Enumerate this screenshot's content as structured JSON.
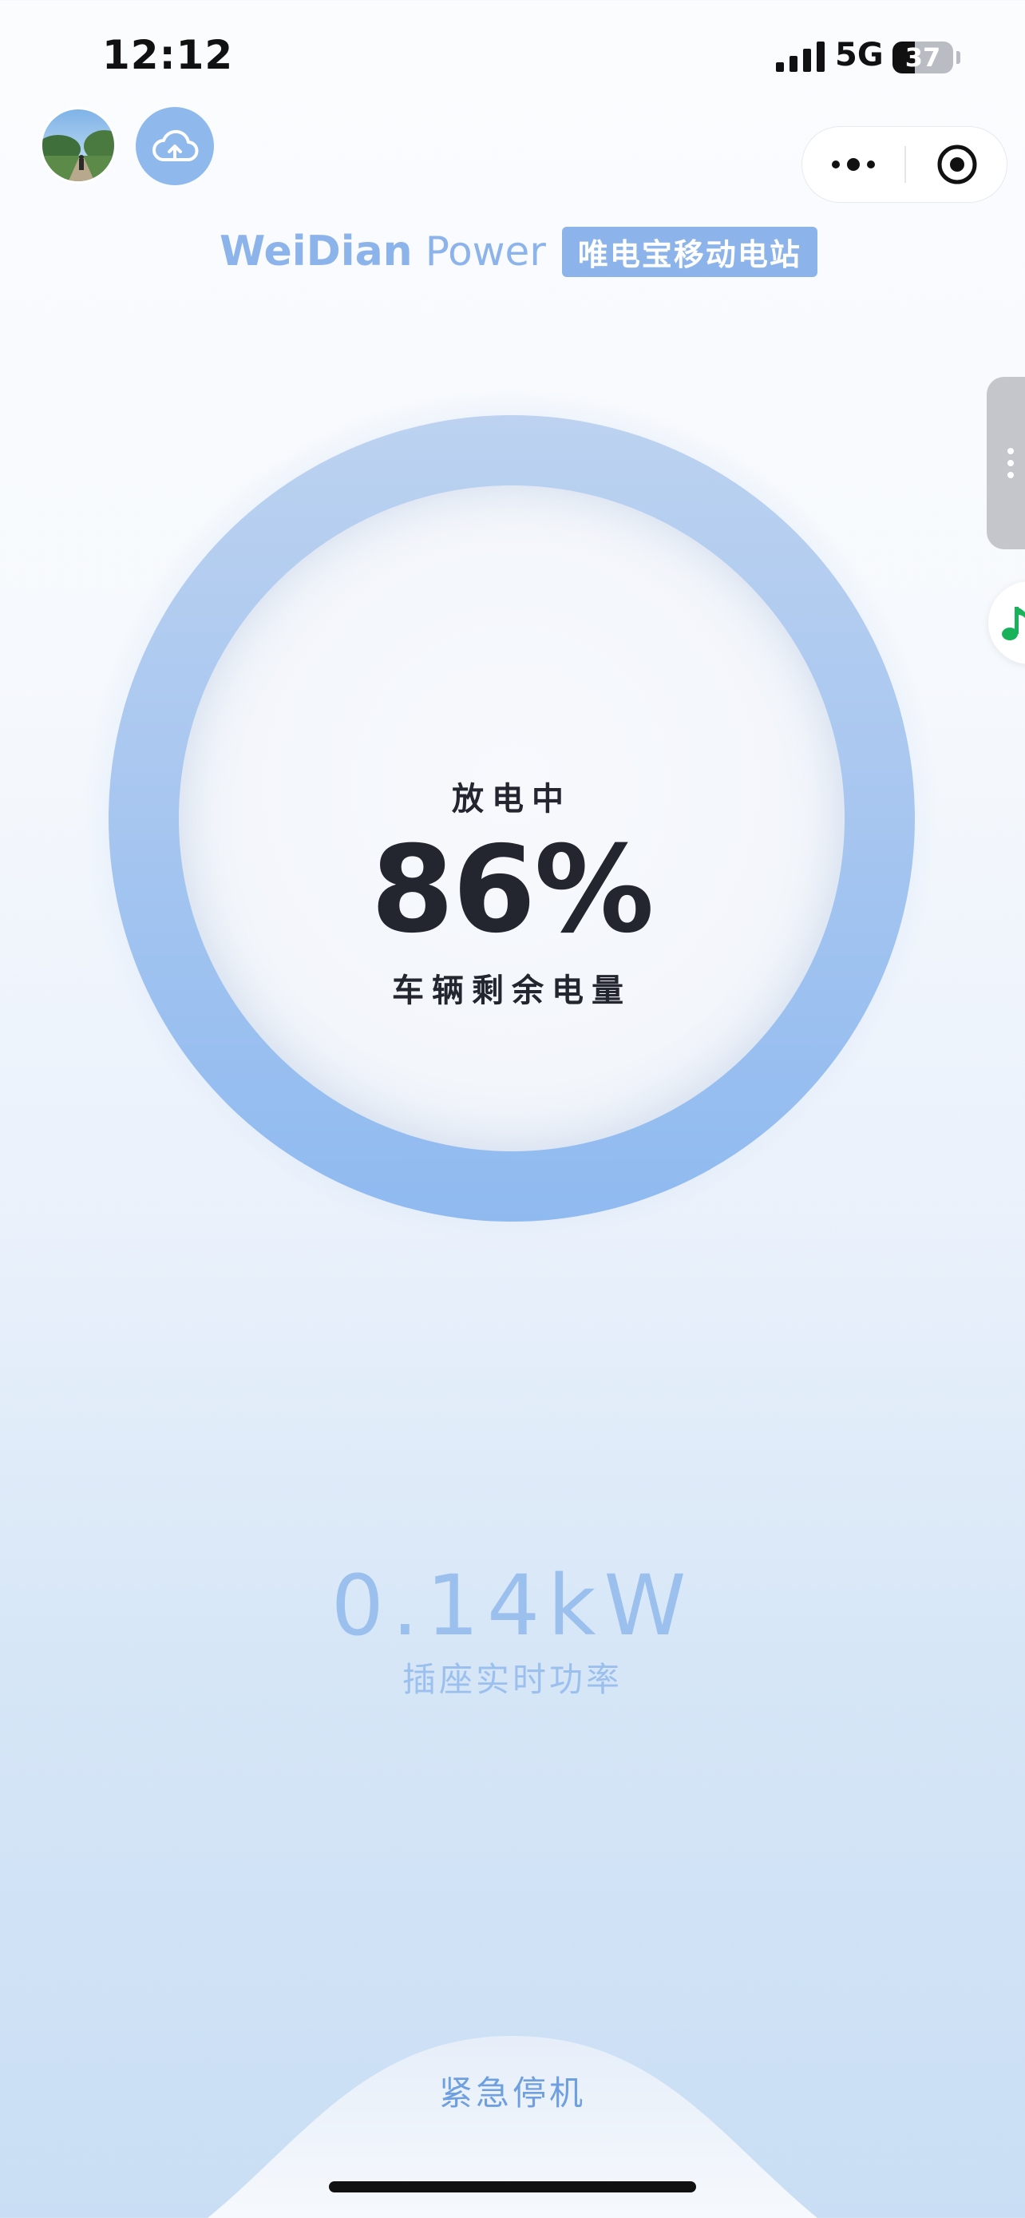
{
  "status_bar": {
    "time": "12:12",
    "network": "5G",
    "battery_text": "37",
    "battery_level": 0.37
  },
  "header": {
    "avatar_icon": "avatar-photo",
    "upload_icon": "cloud-upload-icon",
    "more_icon": "more-dots-icon",
    "close_icon": "target-close-icon"
  },
  "brand": {
    "name_bold": "WeiDian",
    "name_light": "Power",
    "badge": "唯电宝移动电站"
  },
  "gauge": {
    "status": "放电中",
    "percent": "86%",
    "label": "车辆剩余电量",
    "level": 0.86
  },
  "side": {
    "menu_icon": "vertical-dots-icon",
    "music_icon": "music-note-icon",
    "music_color": "#18b25a"
  },
  "power": {
    "value": "0.14kW",
    "label": "插座实时功率"
  },
  "bottom": {
    "stop_label": "紧急停机"
  },
  "colors": {
    "accent": "#8db4ea",
    "text_dark": "#23262f",
    "power_text": "#9cc0ee",
    "stop_text": "#6e9fe0"
  }
}
